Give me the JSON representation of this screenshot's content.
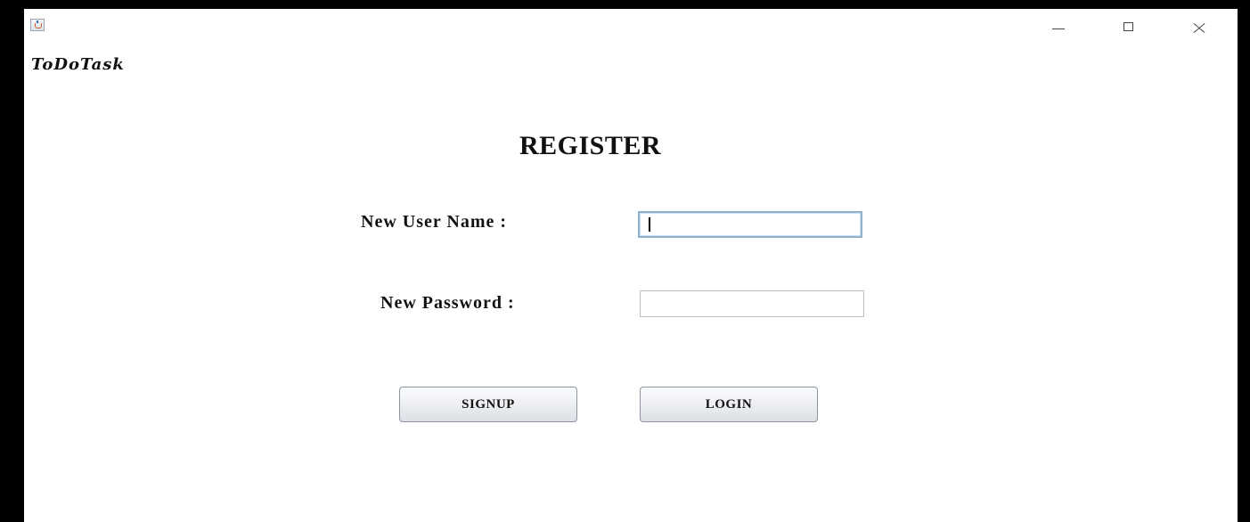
{
  "window": {
    "title": "",
    "controls": [
      "minimize",
      "maximize",
      "close"
    ]
  },
  "app": {
    "brand": "ToDoTask"
  },
  "form": {
    "title": "REGISTER",
    "username_label": "New User Name :",
    "username_value": "",
    "password_label": "New Password :",
    "password_value": ""
  },
  "buttons": {
    "signup_label": "SIGNUP",
    "login_label": "LOGIN"
  },
  "icons": {
    "app": "java-app-icon",
    "minimize": "minimize-icon",
    "maximize": "maximize-icon",
    "close": "close-icon"
  }
}
